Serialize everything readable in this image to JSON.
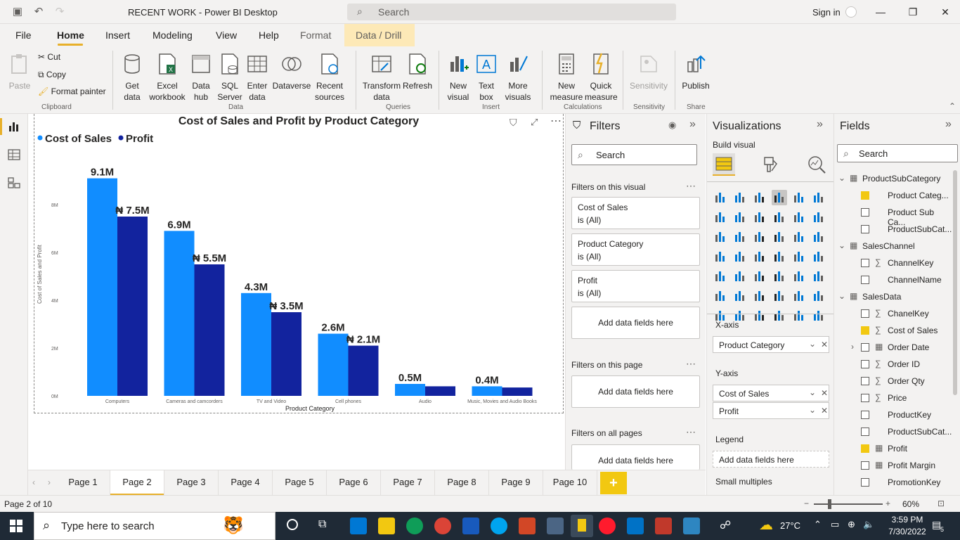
{
  "window": {
    "title": "RECENT WORK - Power BI Desktop",
    "search_placeholder": "Search",
    "sign_in": "Sign in"
  },
  "menu": {
    "items": [
      "File",
      "Home",
      "Insert",
      "Modeling",
      "View",
      "Help",
      "Format",
      "Data / Drill"
    ]
  },
  "ribbon": {
    "clipboard": {
      "paste": "Paste",
      "cut": "Cut",
      "copy": "Copy",
      "format_painter": "Format painter",
      "group": "Clipboard"
    },
    "data": {
      "get_data": "Get data",
      "excel": "Excel workbook",
      "data_hub": "Data hub",
      "sql": "SQL Server",
      "enter": "Enter data",
      "dataverse": "Dataverse",
      "recent": "Recent sources",
      "group": "Data"
    },
    "queries": {
      "transform": "Transform data",
      "refresh": "Refresh",
      "group": "Queries"
    },
    "insert": {
      "new_visual": "New visual",
      "text_box": "Text box",
      "more_visuals": "More visuals",
      "group": "Insert"
    },
    "calculations": {
      "new_measure": "New measure",
      "quick_measure": "Quick measure",
      "group": "Calculations"
    },
    "sensitivity": {
      "label": "Sensitivity",
      "group": "Sensitivity"
    },
    "share": {
      "publish": "Publish",
      "group": "Share"
    }
  },
  "chart_data": {
    "type": "bar",
    "title": "Cost of Sales and Profit by Product Category",
    "xlabel": "Product Category",
    "ylabel": "Cost of Sales and Profit",
    "categories": [
      "Computers",
      "Cameras and camcorders",
      "TV and Video",
      "Cell phones",
      "Audio",
      "Music, Movies and Audio Books"
    ],
    "series": [
      {
        "name": "Cost of Sales",
        "color": "#118dff",
        "values": [
          9.1,
          6.9,
          4.3,
          2.6,
          0.5,
          0.4
        ],
        "labels": [
          "9.1M",
          "6.9M",
          "4.3M",
          "2.6M",
          "0.5M",
          "0.4M"
        ]
      },
      {
        "name": "Profit",
        "color": "#12239e",
        "values": [
          7.5,
          5.5,
          3.5,
          2.1,
          0.4,
          0.35
        ],
        "labels": [
          "₦ 7.5M",
          "₦ 5.5M",
          "₦ 3.5M",
          "₦ 2.1M",
          "",
          ""
        ]
      }
    ],
    "yticks": [
      "0M",
      "2M",
      "4M",
      "6M",
      "8M"
    ],
    "ylim": [
      0,
      10
    ],
    "legend": "top-left"
  },
  "filters": {
    "title": "Filters",
    "search": "Search",
    "on_visual": "Filters on this visual",
    "cards": [
      {
        "name": "Cost of Sales",
        "state": "is (All)"
      },
      {
        "name": "Product Category",
        "state": "is (All)"
      },
      {
        "name": "Profit",
        "state": "is (All)"
      }
    ],
    "add_fields": "Add data fields here",
    "on_page": "Filters on this page",
    "on_all": "Filters on all pages"
  },
  "visualizations": {
    "title": "Visualizations",
    "build": "Build visual",
    "xaxis": "X-axis",
    "xaxis_field": "Product Category",
    "yaxis": "Y-axis",
    "yaxis_fields": [
      "Cost of Sales",
      "Profit"
    ],
    "legend": "Legend",
    "legend_placeholder": "Add data fields here",
    "small_multiples": "Small multiples"
  },
  "fields": {
    "title": "Fields",
    "search": "Search",
    "items": [
      {
        "label": "ProductSubCategory",
        "kind": "table",
        "checked": false
      },
      {
        "label": "Product Categ...",
        "kind": "field",
        "checked": true
      },
      {
        "label": "Product Sub Ca...",
        "kind": "field",
        "checked": false
      },
      {
        "label": "ProductSubCat...",
        "kind": "field",
        "checked": false
      },
      {
        "label": "SalesChannel",
        "kind": "table",
        "checked": false
      },
      {
        "label": "ChannelKey",
        "kind": "sigma",
        "checked": false
      },
      {
        "label": "ChannelName",
        "kind": "field",
        "checked": false
      },
      {
        "label": "SalesData",
        "kind": "table",
        "checked": false
      },
      {
        "label": "ChanelKey",
        "kind": "sigma",
        "checked": false
      },
      {
        "label": "Cost of Sales",
        "kind": "sigma",
        "checked": true
      },
      {
        "label": "Order Date",
        "kind": "date",
        "checked": false
      },
      {
        "label": "Order ID",
        "kind": "sigma",
        "checked": false
      },
      {
        "label": "Order Qty",
        "kind": "sigma",
        "checked": false
      },
      {
        "label": "Price",
        "kind": "sigma",
        "checked": false
      },
      {
        "label": "ProductKey",
        "kind": "field",
        "checked": false
      },
      {
        "label": "ProductSubCat...",
        "kind": "field",
        "checked": false
      },
      {
        "label": "Profit",
        "kind": "measure",
        "checked": true
      },
      {
        "label": "Profit Margin",
        "kind": "measure",
        "checked": false
      },
      {
        "label": "PromotionKey",
        "kind": "field",
        "checked": false
      }
    ]
  },
  "pages": {
    "tabs": [
      "Page 1",
      "Page 2",
      "Page 3",
      "Page 4",
      "Page 5",
      "Page 6",
      "Page 7",
      "Page 8",
      "Page 9",
      "Page 10"
    ],
    "active": 1,
    "add": "+"
  },
  "status": {
    "page_info": "Page 2 of 10",
    "zoom": "60%"
  },
  "taskbar": {
    "search_placeholder": "Type here to search",
    "temperature": "27°C",
    "time": "3:59 PM",
    "date": "7/30/2022",
    "notifications": "5"
  }
}
